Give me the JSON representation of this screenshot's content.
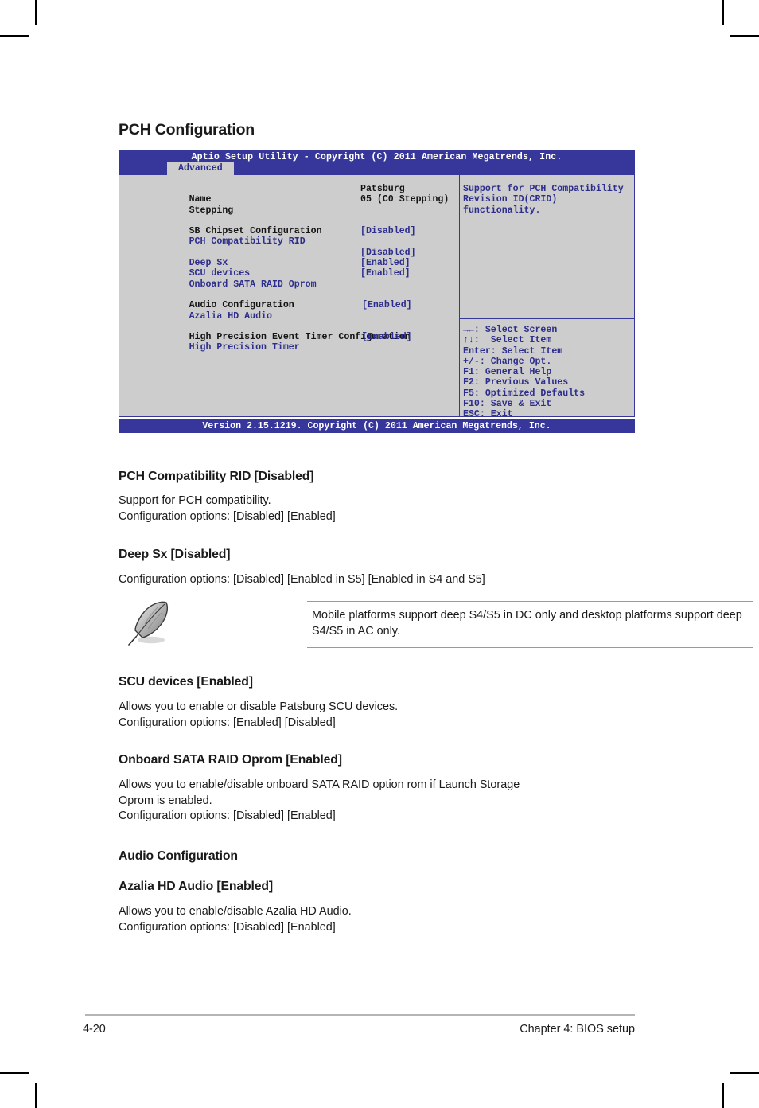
{
  "page": {
    "section_title": "PCH Configuration",
    "footer_page_number": "4-20",
    "footer_chapter": "Chapter 4: BIOS setup"
  },
  "bios": {
    "title": "Aptio Setup Utility - Copyright (C) 2011 American Megatrends, Inc.",
    "active_tab": "Advanced",
    "version_bar": "Version 2.15.1219. Copyright (C) 2011 American Megatrends, Inc.",
    "items": [
      {
        "label": "Name",
        "value": "Patsburg",
        "kind": "static"
      },
      {
        "label": "Stepping",
        "value": "05 (C0 Stepping)",
        "kind": "static"
      },
      {
        "label": "SB Chipset Configuration",
        "value": "",
        "kind": "heading"
      },
      {
        "label": "PCH Compatibility RID",
        "value": "[Disabled]",
        "kind": "option"
      },
      {
        "label": "Deep Sx",
        "value": "[Disabled]",
        "kind": "option"
      },
      {
        "label": "SCU devices",
        "value": "[Enabled]",
        "kind": "option"
      },
      {
        "label": "Onboard SATA RAID Oprom",
        "value": "[Enabled]",
        "kind": "option"
      },
      {
        "label": "Audio Configuration",
        "value": "",
        "kind": "heading"
      },
      {
        "label": "Azalia HD Audio",
        "value": "[Enabled]",
        "kind": "option"
      },
      {
        "label": "High Precision Event Timer Configuration",
        "value": "",
        "kind": "heading"
      },
      {
        "label": "High Precision Timer",
        "value": "[Enabled]",
        "kind": "option"
      }
    ],
    "help": {
      "line1": "Support for PCH Compatibility",
      "line2": "Revision ID(CRID)",
      "line3": "functionality."
    },
    "keys": [
      "→←: Select Screen",
      "↑↓:  Select Item",
      "Enter: Select Item",
      "+/-: Change Opt.",
      "F1: General Help",
      "F2: Previous Values",
      "F5: Optimized Defaults",
      "F10: Save & Exit",
      "ESC: Exit"
    ]
  },
  "sections": [
    {
      "heading": "PCH Compatibility RID [Disabled]",
      "body": "Support for PCH compatibility.\nConfiguration options: [Disabled] [Enabled]"
    },
    {
      "heading": "Deep Sx [Disabled]",
      "body": "Configuration options: [Disabled] [Enabled in S5] [Enabled in S4 and S5]"
    },
    {
      "heading": "SCU devices [Enabled]",
      "body": "Allows you to enable or disable Patsburg SCU devices.\nConfiguration options: [Enabled] [Disabled]"
    },
    {
      "heading": "Onboard SATA RAID Oprom [Enabled]",
      "body": "Allows you to enable/disable onboard SATA RAID option rom if Launch Storage\nOprom is enabled.\nConfiguration options: [Disabled] [Enabled]"
    },
    {
      "heading": "Audio Configuration",
      "body": ""
    },
    {
      "heading": "Azalia HD Audio [Enabled]",
      "body": "Allows you to enable/disable Azalia HD Audio.\nConfiguration options: [Disabled] [Enabled]"
    }
  ],
  "note": {
    "icon": "quill-pen-icon",
    "text": "Mobile platforms support deep S4/S5 in DC only and desktop platforms support deep S4/S5 in AC only."
  },
  "colors": {
    "bios_blue": "#37379b",
    "bios_panel_gray": "#cdcdcd",
    "bios_option_text": "#2d2d8c"
  }
}
